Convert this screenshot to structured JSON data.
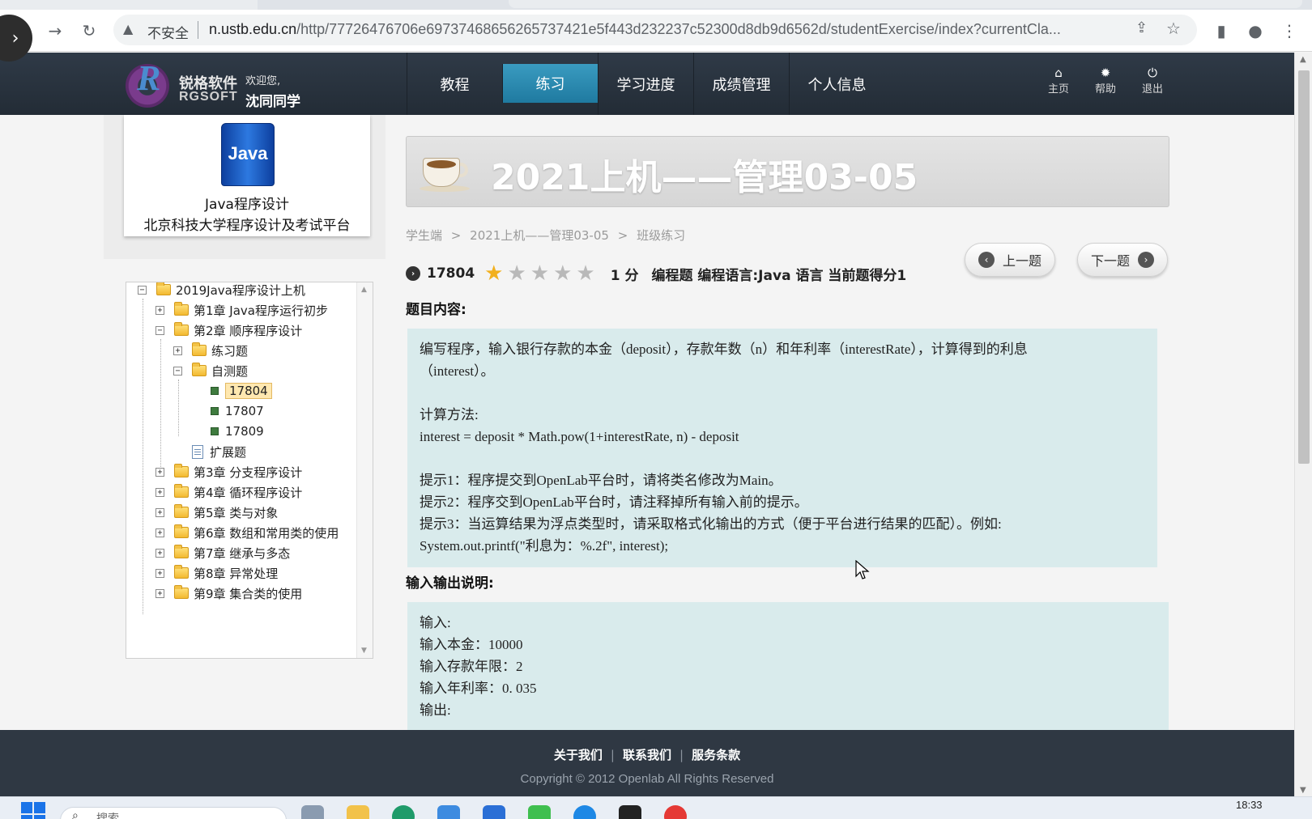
{
  "browser": {
    "security_label": "不安全",
    "url_domain": "n.ustb.edu.cn",
    "url_rest": "/http/77726476706e69737468656265737421e5f443d232237c52300d8db9d6562d/studentExercise/index?currentCla..."
  },
  "header": {
    "brand_cn": "锐格软件",
    "brand_en": "RGSOFT",
    "welcome": "欢迎您,",
    "username": "沈同同学",
    "nav": [
      {
        "label": "教程"
      },
      {
        "label": "练习"
      },
      {
        "label": "学习进度"
      },
      {
        "label": "成绩管理"
      },
      {
        "label": "个人信息"
      }
    ],
    "active_nav": "练习",
    "util": [
      {
        "label": "主页"
      },
      {
        "label": "帮助"
      },
      {
        "label": "退出"
      }
    ]
  },
  "course": {
    "book_text": "Java",
    "title": "Java程序设计",
    "subtitle": "北京科技大学程序设计及考试平台"
  },
  "tree": {
    "root": "2019Java程序设计上机",
    "ch1": "第1章 Java程序运行初步",
    "ch2": "第2章 顺序程序设计",
    "ch2_practice": "练习题",
    "ch2_selftest": "自测题",
    "q1": "17804",
    "q2": "17807",
    "q3": "17809",
    "ch2_extend": "扩展题",
    "ch3": "第3章 分支程序设计",
    "ch4": "第4章 循环程序设计",
    "ch5": "第5章 类与对象",
    "ch6": "第6章 数组和常用类的使用",
    "ch7": "第7章 继承与多态",
    "ch8": "第8章 异常处理",
    "ch9": "第9章 集合类的使用",
    "selected": "17804"
  },
  "banner": {
    "title": "2021上机——管理03-05"
  },
  "breadcrumb": {
    "items": [
      "学生端",
      ">",
      "2021上机——管理03-05",
      ">",
      "班级练习"
    ]
  },
  "pager": {
    "prev": "上一题",
    "next": "下一题"
  },
  "question": {
    "id": "17804",
    "difficulty_stars": 1,
    "max_stars": 5,
    "points": "1 分",
    "info": "编程题 编程语言:Java 语言 当前题得分1"
  },
  "content": {
    "heading": "题目内容:",
    "lines": [
      "编写程序，输入银行存款的本金（deposit），存款年数（n）和年利率（interestRate），计算得到的利息",
      "（interest）。",
      "",
      "计算方法:",
      "interest = deposit * Math.pow(1+interestRate, n) - deposit",
      "",
      "提示1：程序提交到OpenLab平台时，请将类名修改为Main。",
      "提示2：程序交到OpenLab平台时，请注释掉所有输入前的提示。",
      "提示3：当运算结果为浮点类型时，请采取格式化输出的方式（便于平台进行结果的匹配）。例如:",
      "System.out.printf(\"利息为：%.2f\", interest);"
    ]
  },
  "io": {
    "heading": "输入输出说明:",
    "lines": [
      "输入:",
      "输入本金：10000",
      "输入存款年限：2",
      "输入年利率：0. 035",
      "输出:"
    ]
  },
  "footer": {
    "about": "关于我们",
    "contact": "联系我们",
    "terms": "服务条款",
    "copyright": "Copyright © 2012 Openlab All Rights Reserved"
  },
  "taskbar": {
    "search_placeholder": "搜索",
    "time": "18:33"
  },
  "colors": {
    "header_bg": "#2a333e",
    "nav_active": "#2b8bb2",
    "content_bg": "#d9ebec",
    "star_on": "#f2b01e",
    "star_off": "#b9b9b9"
  }
}
